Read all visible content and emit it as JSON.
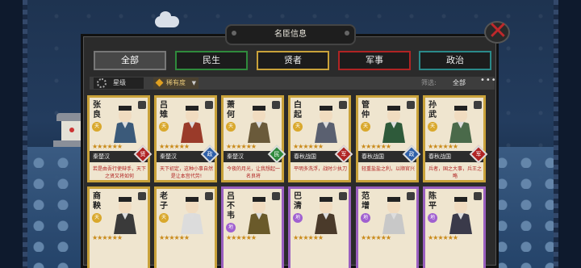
{
  "window": {
    "title": "名臣信息"
  },
  "tabs": [
    {
      "label": "全部",
      "active": true,
      "color": "#777777"
    },
    {
      "label": "民生",
      "active": false,
      "color": "#2f8a3c"
    },
    {
      "label": "贤者",
      "active": false,
      "color": "#c9a23a"
    },
    {
      "label": "军事",
      "active": false,
      "color": "#b02424"
    },
    {
      "label": "政治",
      "active": false,
      "color": "#2a8a8a"
    }
  ],
  "filter": {
    "star_label": "星级",
    "sort_label": "稀有度",
    "filter_label": "筛选:",
    "filter_value": "全部",
    "more": "•••"
  },
  "icons": {
    "close": "close-icon",
    "gear": "gear-icon",
    "diamond": "diamond-icon",
    "chevron": "chevron-down-icon"
  },
  "cards": [
    {
      "name": "张良",
      "grade": "天",
      "era": "秦楚汉",
      "role": "贤",
      "role_class": "r-xian",
      "desc": "若是由吾行使辩手，天下之贤又将如何",
      "stars": "★★★★★★",
      "frame": "gold",
      "robe": "#3b5a7a"
    },
    {
      "name": "吕雉",
      "grade": "天",
      "era": "秦楚汉",
      "role": "政",
      "role_class": "r-zheng",
      "desc": "天下初定，这种小事自然是让本宫代劳!",
      "stars": "★★★★★★",
      "frame": "gold",
      "robe": "#9a3b2a"
    },
    {
      "name": "萧何",
      "grade": "天",
      "era": "秦楚汉",
      "role": "民",
      "role_class": "r-min",
      "desc": "今夜的月光，让我想起一名良将",
      "stars": "★★★★★★",
      "frame": "gold",
      "robe": "#6a5a3a"
    },
    {
      "name": "白起",
      "grade": "天",
      "era": "春秋战国",
      "role": "军",
      "role_class": "r-xian",
      "desc": "平明多洗浮，战时少执刀",
      "stars": "★★★★★★",
      "frame": "gold",
      "robe": "#5a6070"
    },
    {
      "name": "管仲",
      "grade": "天",
      "era": "春秋战国",
      "role": "政",
      "role_class": "r-zheng",
      "desc": "轻重盐盐之利，以顺官兴",
      "stars": "★★★★★★",
      "frame": "gold",
      "robe": "#2e5a3a"
    },
    {
      "name": "孙武",
      "grade": "天",
      "era": "春秋战国",
      "role": "军",
      "role_class": "r-xian",
      "desc": "兵者，国之大事，兵王之略",
      "stars": "★★★★★★",
      "frame": "gold",
      "robe": "#4a6a4a"
    },
    {
      "name": "商鞅",
      "grade": "天",
      "era": "",
      "role": "",
      "role_class": "",
      "desc": "",
      "stars": "★★★★★★",
      "frame": "gold",
      "robe": "#3a3a3a"
    },
    {
      "name": "老子",
      "grade": "天",
      "era": "",
      "role": "",
      "role_class": "",
      "desc": "",
      "stars": "★★★★★★",
      "frame": "gold",
      "robe": "#dcdcdc"
    },
    {
      "name": "吕不韦",
      "grade": "地",
      "era": "",
      "role": "",
      "role_class": "",
      "desc": "",
      "stars": "★★★★★★",
      "frame": "purple",
      "robe": "#6a5a2a"
    },
    {
      "name": "巴清",
      "grade": "地",
      "era": "",
      "role": "",
      "role_class": "",
      "desc": "",
      "stars": "★★★★★★",
      "frame": "purple",
      "robe": "#4a3a2a"
    },
    {
      "name": "范增",
      "grade": "地",
      "era": "",
      "role": "",
      "role_class": "",
      "desc": "",
      "stars": "★★★★★★",
      "frame": "purple",
      "robe": "#c8c8c8"
    },
    {
      "name": "陈平",
      "grade": "地",
      "era": "",
      "role": "",
      "role_class": "",
      "desc": "",
      "stars": "★★★★★★",
      "frame": "purple",
      "robe": "#3a3a4a"
    }
  ]
}
